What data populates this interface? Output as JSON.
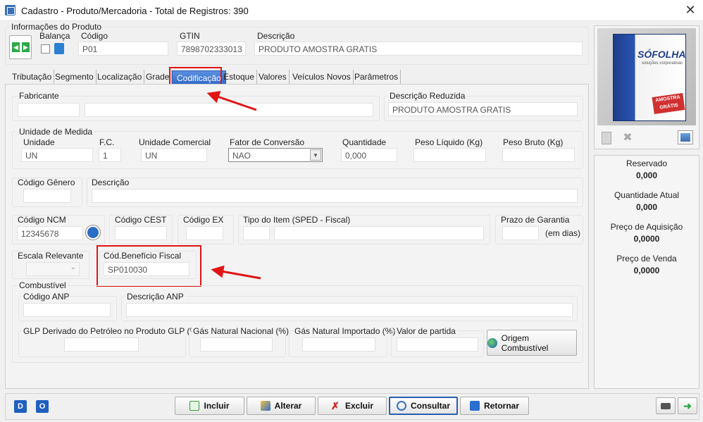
{
  "window": {
    "title": "Cadastro - Produto/Mercadoria - Total de Registros: 390"
  },
  "header": {
    "group_label": "Informações do Produto",
    "balanca_label": "Balança",
    "codigo_label": "Código",
    "codigo_value": "P01",
    "gtin_label": "GTIN",
    "gtin_value": "7898702333013",
    "descricao_label": "Descrição",
    "descricao_value": "PRODUTO AMOSTRA GRATIS"
  },
  "tabs": [
    {
      "label": "Tributação"
    },
    {
      "label": "Segmento"
    },
    {
      "label": "Localização"
    },
    {
      "label": "Grade"
    },
    {
      "label": "Codificação"
    },
    {
      "label": "Estoque"
    },
    {
      "label": "Valores"
    },
    {
      "label": "Veículos Novos"
    },
    {
      "label": "Parâmetros"
    }
  ],
  "codificacao": {
    "fabricante_label": "Fabricante",
    "desc_reduzida_label": "Descrição Reduzida",
    "desc_reduzida_value": "PRODUTO AMOSTRA GRATIS",
    "unidade_medida_label": "Unidade de Medida",
    "unidade_label": "Unidade",
    "unidade_value": "UN",
    "fc_label": "F.C.",
    "fc_value": "1",
    "unidade_comercial_label": "Unidade Comercial",
    "unidade_comercial_value": "UN",
    "fator_conversao_label": "Fator de Conversão",
    "fator_conversao_value": "NAO",
    "quantidade_label": "Quantidade",
    "quantidade_value": "0,000",
    "peso_liquido_label": "Peso Líquido (Kg)",
    "peso_bruto_label": "Peso Bruto (Kg)",
    "codigo_genero_label": "Código Gênero",
    "descricao_label": "Descrição",
    "ncm_label": "Código NCM",
    "ncm_value": "12345678",
    "cest_label": "Código CEST",
    "ex_label": "Código EX",
    "tipo_item_label": "Tipo do Item (SPED - Fiscal)",
    "prazo_garantia_label": "Prazo de Garantia",
    "em_dias": "(em dias)",
    "escala_label": "Escala Relevante",
    "beneficio_label": "Cód.Benefício Fiscal",
    "beneficio_value": "SP010030",
    "combustivel_label": "Combustível",
    "anp_label": "Código ANP",
    "desc_anp_label": "Descrição ANP",
    "glp_label": "GLP Derivado do Petróleo no Produto GLP (%)",
    "gnn_label": "Gás Natural Nacional (%)",
    "gni_label": "Gás Natural Importado (%)",
    "valor_partida_label": "Valor de partida",
    "origem_btn": "Origem Combustível"
  },
  "side": {
    "product_brand": "SÓFOLHA",
    "product_tagline": "soluções corporativas",
    "product_stamp": "AMOSTRA GRÁTIS",
    "reservado_label": "Reservado",
    "reservado_value": "0,000",
    "qtd_atual_label": "Quantidade Atual",
    "qtd_atual_value": "0,000",
    "preco_aquisicao_label": "Preço de Aquisição",
    "preco_aquisicao_value": "0,0000",
    "preco_venda_label": "Preço de Venda",
    "preco_venda_value": "0,0000"
  },
  "footer": {
    "d_label": "D",
    "o_label": "O",
    "incluir": "Incluir",
    "alterar": "Alterar",
    "excluir": "Excluir",
    "consultar": "Consultar",
    "retornar": "Retornar"
  },
  "colors": {
    "accent": "#2f68c8",
    "annotation_red": "#e01515"
  }
}
